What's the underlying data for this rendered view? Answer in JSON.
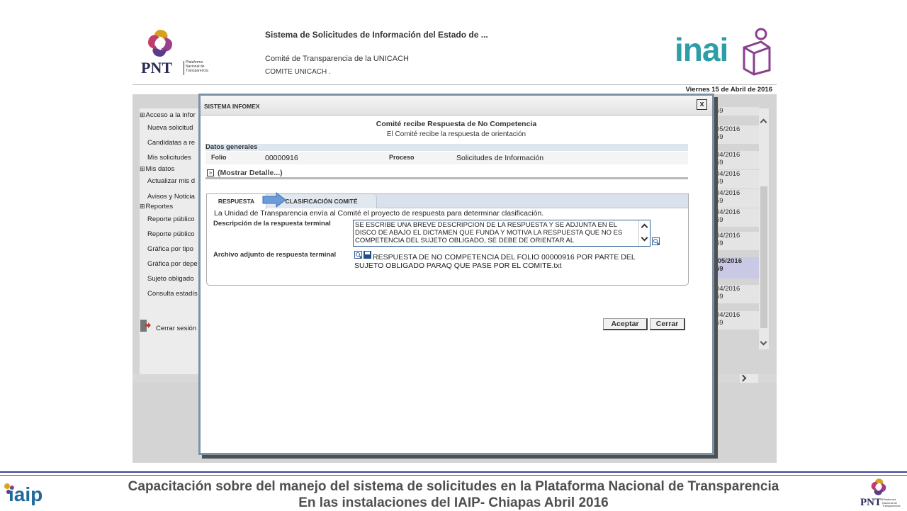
{
  "app": {
    "system_title": "Sistema de Solicitudes de Información del Estado de ...",
    "committee_name": "Comité de Transparencia de la UNICACH",
    "committee_user": "COMITE UNICACH .",
    "date_label": "Viernes 15 de Abril de 2016",
    "pnt_logo_text": "PNT",
    "pnt_logo_sub": [
      "Plataforma",
      "Nacional de",
      "Transparencia"
    ],
    "inai_logo_text": "inai"
  },
  "sidebar": {
    "items": [
      {
        "type": "head",
        "label": "Acceso a la infor"
      },
      {
        "type": "item",
        "label": "Nueva solicitud"
      },
      {
        "type": "item",
        "label": "Candidatas a re"
      },
      {
        "type": "item",
        "label": "Mis solicitudes"
      },
      {
        "type": "head",
        "label": "Mis datos"
      },
      {
        "type": "item",
        "label": "Actualizar mis d"
      },
      {
        "type": "item",
        "label": "Avisos y Noticia"
      },
      {
        "type": "head",
        "label": "Reportes"
      },
      {
        "type": "item",
        "label": "Reporte público"
      },
      {
        "type": "item",
        "label": "Reporte público"
      },
      {
        "type": "item",
        "label": "Gráfica por tipo"
      },
      {
        "type": "item",
        "label": "Gráfica por depe"
      },
      {
        "type": "item",
        "label": "Sujeto obligado"
      },
      {
        "type": "item",
        "label": "Consulta estadís"
      }
    ],
    "logout_label": "Cerrar sesión"
  },
  "background_list": {
    "dates": [
      {
        "line1": "",
        "line2": "59"
      },
      {
        "line1": "05/2016",
        "line2": "59"
      },
      {
        "line1": "04/2016",
        "line2": "59"
      },
      {
        "line1": "04/2016",
        "line2": "59"
      },
      {
        "line1": "04/2016",
        "line2": "59"
      },
      {
        "line1": "04/2016",
        "line2": "59"
      },
      {
        "line1": "04/2016",
        "line2": "59"
      },
      {
        "line1": "/05/2016",
        "line2": "59"
      },
      {
        "line1": "04/2016",
        "line2": "59"
      },
      {
        "line1": "04/2016",
        "line2": "59"
      }
    ]
  },
  "modal": {
    "window_title": "SISTEMA INFOMEX",
    "heading": "Comité recibe Respuesta de No Competencia",
    "subheading": "El Comité recibe la respuesta de orientación",
    "general_section": "Datos generales",
    "folio_label": "Folio",
    "folio_value": "00000916",
    "proceso_label": "Proceso",
    "proceso_value": "Solicitudes de Información",
    "show_detail": "(Mostrar Detalle...)",
    "tabs": [
      {
        "label": "RESPUESTA",
        "active": true
      },
      {
        "label": "CLASIFICACIÓN COMITÉ",
        "active": false
      }
    ],
    "tab_intro": "La Unidad de Transparencia envía al Comité el proyecto de respuesta para determinar clasificación.",
    "desc_label": "Descripción de la respuesta terminal",
    "desc_value": "SE ESCRIBE UNA BREVE DESCRIPCION DE LA RESPUESTA  Y SE ADJUNTA EN EL DISCO DE ABAJO EL DICTAMEN QUE FUNDA Y MOTIVA LA RESPUESTA QUE NO ES COMPETENCIA DEL SUJETO OBLIGADO, SE DEBE DE ORIENTAR AL",
    "attach_label": "Archivo adjunto de respuesta terminal",
    "attach_value": "RESPUESTA DE NO COMPETENCIA DEL FOLIO 00000916 POR PARTE DEL SUJETO OBLIGADO PARAQ QUE PASE POR EL COMITE.txt",
    "accept_label": "Aceptar",
    "close_label": "Cerrar",
    "close_x": "x"
  },
  "footer": {
    "line1": "Capacitación sobre del manejo del sistema de solicitudes en la Plataforma Nacional de Transparencia",
    "line2": "En las instalaciones del IAIP- Chiapas    Abril 2016",
    "iaip_logo_text": "iaip"
  },
  "colors": {
    "accent_blue": "#2f5f9a",
    "tab_bar": "#d9e2ec",
    "arrow_blue": "#6b9bd8",
    "footer_line": "#3b3fa0"
  }
}
